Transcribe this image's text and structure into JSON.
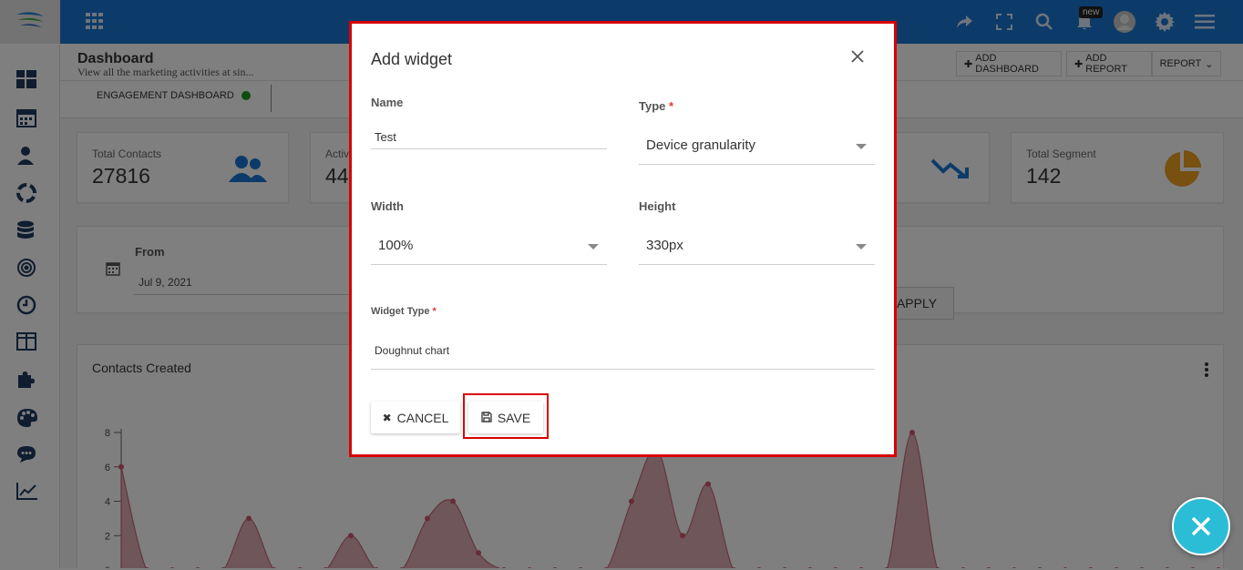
{
  "header": {
    "notification_badge": "new",
    "icons": [
      "share-icon",
      "fullscreen-icon",
      "search-icon",
      "bell-icon",
      "avatar",
      "gear-icon",
      "hamburger-menu-icon"
    ]
  },
  "page": {
    "title": "Dashboard",
    "subtitle": "View all the marketing activities at sin...",
    "add_dashboard_label": "ADD DASHBOARD",
    "add_report_label": "ADD REPORT",
    "report_label": "REPORT"
  },
  "tabs": [
    {
      "label": "ENGAGEMENT DASHBOARD",
      "status_color": "#1a9c1a"
    }
  ],
  "stats": [
    {
      "label": "Total Contacts",
      "value": "27816"
    },
    {
      "label": "Activ",
      "value": "44"
    },
    {
      "label": "Total Segment",
      "value": "142"
    }
  ],
  "filter": {
    "from_label": "From",
    "from_value": "Jul 9, 2021",
    "apply_label": "APPLY"
  },
  "chart_card": {
    "title": "Contacts Created"
  },
  "chart_data": {
    "type": "area",
    "title": "Contacts Created",
    "yticks": [
      "8",
      "6",
      "4",
      "2",
      "0"
    ],
    "ylim": [
      0,
      8
    ],
    "values": [
      6,
      0,
      0,
      0,
      0,
      3,
      0,
      0,
      0,
      2,
      0,
      0,
      3,
      4,
      1,
      0,
      0,
      0,
      0,
      0,
      4,
      7,
      2,
      5,
      0,
      0,
      0,
      0,
      0,
      0,
      0,
      8,
      0,
      0,
      0,
      0,
      0,
      0,
      0,
      0,
      0,
      0,
      0,
      0
    ],
    "color": "#c46a7a"
  },
  "modal": {
    "title": "Add widget",
    "name_label": "Name",
    "name_value": "Test",
    "type_label": "Type",
    "type_value": "Device granularity",
    "width_label": "Width",
    "width_value": "100%",
    "height_label": "Height",
    "height_value": "330px",
    "widget_type_label": "Widget Type",
    "widget_type_value": "Doughnut chart",
    "required_mark": "*",
    "cancel_label": "CANCEL",
    "save_label": "SAVE",
    "highlight_color": "#d90000"
  },
  "colors": {
    "topbar": "#1976d2",
    "accent_icon": "#1976d2",
    "segment_icon": "#f0a020",
    "fab": "#2bbcd6"
  }
}
